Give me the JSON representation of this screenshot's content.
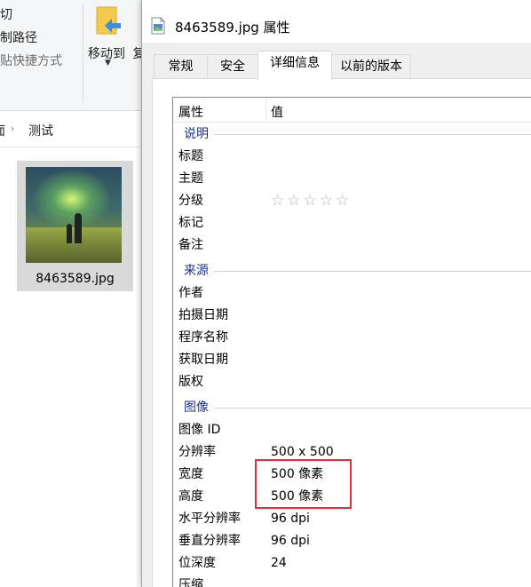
{
  "explorer": {
    "ribbon": {
      "cut_label": "剪切",
      "copy_path_label": "复制路径",
      "paste_shortcut_label": "粘贴快捷方式",
      "move_to_label": "移动到",
      "copy_to_partial": "复"
    },
    "address": {
      "prev_partial": "面",
      "current": "测试"
    },
    "file": {
      "name": "8463589.jpg"
    }
  },
  "dialog": {
    "title": "8463589.jpg 属性",
    "tabs": [
      {
        "label": "常规",
        "active": false
      },
      {
        "label": "安全",
        "active": false
      },
      {
        "label": "详细信息",
        "active": true
      },
      {
        "label": "以前的版本",
        "active": false
      }
    ],
    "columns": {
      "property": "属性",
      "value": "值"
    },
    "groups": {
      "description": "说明",
      "origin": "来源",
      "image": "图像"
    },
    "rows": {
      "title": {
        "key": "标题",
        "value": ""
      },
      "subject": {
        "key": "主题",
        "value": ""
      },
      "rating": {
        "key": "分级",
        "stars": "☆☆☆☆☆",
        "rating": 0
      },
      "tags": {
        "key": "标记",
        "value": ""
      },
      "comments": {
        "key": "备注",
        "value": ""
      },
      "authors": {
        "key": "作者",
        "value": ""
      },
      "date_taken": {
        "key": "拍摄日期",
        "value": ""
      },
      "program": {
        "key": "程序名称",
        "value": ""
      },
      "date_acquired": {
        "key": "获取日期",
        "value": ""
      },
      "copyright": {
        "key": "版权",
        "value": ""
      },
      "image_id": {
        "key": "图像 ID",
        "value": ""
      },
      "dimensions": {
        "key": "分辨率",
        "value": "500 x 500"
      },
      "width": {
        "key": "宽度",
        "value": "500 像素"
      },
      "height": {
        "key": "高度",
        "value": "500 像素"
      },
      "h_res": {
        "key": "水平分辨率",
        "value": "96 dpi"
      },
      "v_res": {
        "key": "垂直分辨率",
        "value": "96 dpi"
      },
      "bit_depth": {
        "key": "位深度",
        "value": "24"
      },
      "compression": {
        "key": "压缩",
        "value": ""
      }
    }
  },
  "colors": {
    "group_heading": "#1e3287",
    "highlight_box": "#e0303a",
    "folder_arrow": "#3b8fe0"
  }
}
